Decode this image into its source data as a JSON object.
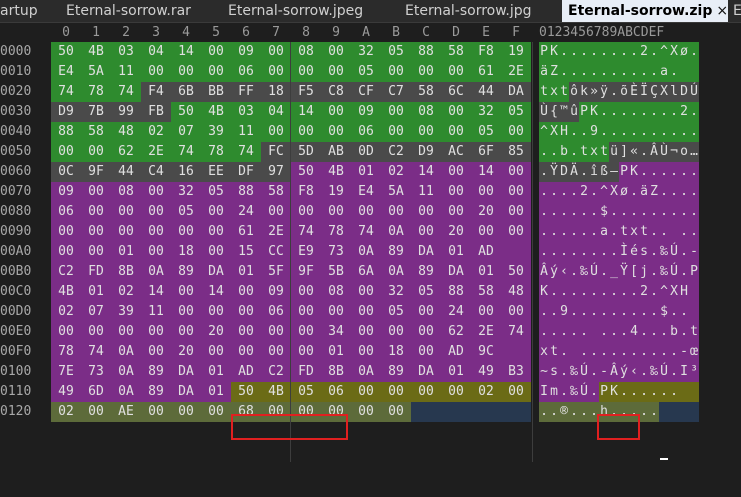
{
  "tabs": [
    {
      "label": "artup"
    },
    {
      "label": "Eternal-sorrow.rar"
    },
    {
      "label": "Eternal-sorrow.jpeg"
    },
    {
      "label": "Eternal-sorrow.jpg"
    },
    {
      "label": "Eternal-sorrow.zip",
      "active": true
    },
    {
      "label": "E"
    }
  ],
  "close_glyph": "×",
  "column_headers": [
    "0",
    "1",
    "2",
    "3",
    "4",
    "5",
    "6",
    "7",
    "8",
    "9",
    "A",
    "B",
    "C",
    "D",
    "E",
    "F"
  ],
  "ascii_header": "0123456789ABCDEF",
  "colors": {
    "green": "#2e8b2e",
    "olive": "#6b6b16",
    "purple": "#7b2d87",
    "mid_grey": "#4a4a4a",
    "navy": "#27384f",
    "light_olive": "#5d6b3a",
    "highlight_border": "#e02020"
  },
  "rows": [
    {
      "offset": "0000",
      "bytes": [
        "50",
        "4B",
        "03",
        "04",
        "14",
        "00",
        "09",
        "00",
        "08",
        "00",
        "32",
        "05",
        "88",
        "58",
        "F8",
        "19"
      ],
      "ascii": "PK........2.^Xø."
    },
    {
      "offset": "0010",
      "bytes": [
        "E4",
        "5A",
        "11",
        "00",
        "00",
        "00",
        "06",
        "00",
        "00",
        "00",
        "05",
        "00",
        "00",
        "00",
        "61",
        "2E"
      ],
      "ascii": "äZ..........a."
    },
    {
      "offset": "0020",
      "bytes": [
        "74",
        "78",
        "74",
        "F4",
        "6B",
        "BB",
        "FF",
        "18",
        "F5",
        "C8",
        "CF",
        "C7",
        "58",
        "6C",
        "44",
        "DA"
      ],
      "ascii": "txtôk»ÿ.õÈÏÇXlDÚ"
    },
    {
      "offset": "0030",
      "bytes": [
        "D9",
        "7B",
        "99",
        "FB",
        "50",
        "4B",
        "03",
        "04",
        "14",
        "00",
        "09",
        "00",
        "08",
        "00",
        "32",
        "05"
      ],
      "ascii": "Ù{™ûPK........2."
    },
    {
      "offset": "0040",
      "bytes": [
        "88",
        "58",
        "48",
        "02",
        "07",
        "39",
        "11",
        "00",
        "00",
        "00",
        "06",
        "00",
        "00",
        "00",
        "05",
        "00"
      ],
      "ascii": "^XH..9.........."
    },
    {
      "offset": "0050",
      "bytes": [
        "00",
        "00",
        "62",
        "2E",
        "74",
        "78",
        "74",
        "FC",
        "5D",
        "AB",
        "0D",
        "C2",
        "D9",
        "AC",
        "6F",
        "85"
      ],
      "ascii": "..b.txtü]«.ÂÙ¬o…"
    },
    {
      "offset": "0060",
      "bytes": [
        "0C",
        "9F",
        "44",
        "C4",
        "16",
        "EE",
        "DF",
        "97",
        "50",
        "4B",
        "01",
        "02",
        "14",
        "00",
        "14",
        "00"
      ],
      "ascii": ".ŸDÄ.îß—PK......"
    },
    {
      "offset": "0070",
      "bytes": [
        "09",
        "00",
        "08",
        "00",
        "32",
        "05",
        "88",
        "58",
        "F8",
        "19",
        "E4",
        "5A",
        "11",
        "00",
        "00",
        "00"
      ],
      "ascii": "....2.^Xø.äZ...."
    },
    {
      "offset": "0080",
      "bytes": [
        "06",
        "00",
        "00",
        "00",
        "05",
        "00",
        "24",
        "00",
        "00",
        "00",
        "00",
        "00",
        "00",
        "00",
        "20",
        "00"
      ],
      "ascii": "......$......... "
    },
    {
      "offset": "0090",
      "bytes": [
        "00",
        "00",
        "00",
        "00",
        "00",
        "00",
        "61",
        "2E",
        "74",
        "78",
        "74",
        "0A",
        "00",
        "20",
        "00",
        "00"
      ],
      "ascii": "......a.txt.. .."
    },
    {
      "offset": "00A0",
      "bytes": [
        "00",
        "00",
        "01",
        "00",
        "18",
        "00",
        "15",
        "CC",
        "E9",
        "73",
        "0A",
        "89",
        "DA",
        "01",
        "AD"
      ],
      "ascii": "........Ìés.‰Ú.-"
    },
    {
      "offset": "00B0",
      "bytes": [
        "C2",
        "FD",
        "8B",
        "0A",
        "89",
        "DA",
        "01",
        "5F",
        "9F",
        "5B",
        "6A",
        "0A",
        "89",
        "DA",
        "01",
        "50"
      ],
      "ascii": "Âý‹.‰Ú._Ÿ[j.‰Ú.P"
    },
    {
      "offset": "00C0",
      "bytes": [
        "4B",
        "01",
        "02",
        "14",
        "00",
        "14",
        "00",
        "09",
        "00",
        "08",
        "00",
        "32",
        "05",
        "88",
        "58",
        "48"
      ],
      "ascii": "K.........2.^XH"
    },
    {
      "offset": "00D0",
      "bytes": [
        "02",
        "07",
        "39",
        "11",
        "00",
        "00",
        "00",
        "06",
        "00",
        "00",
        "00",
        "05",
        "00",
        "24",
        "00",
        "00"
      ],
      "ascii": "..9.........$.."
    },
    {
      "offset": "00E0",
      "bytes": [
        "00",
        "00",
        "00",
        "00",
        "00",
        "20",
        "00",
        "00",
        "00",
        "34",
        "00",
        "00",
        "00",
        "62",
        "2E",
        "74"
      ],
      "ascii": "..... ...4...b.t"
    },
    {
      "offset": "00F0",
      "bytes": [
        "78",
        "74",
        "0A",
        "00",
        "20",
        "00",
        "00",
        "00",
        "00",
        "01",
        "00",
        "18",
        "00",
        "AD",
        "9C"
      ],
      "ascii": "xt. ..........-œ"
    },
    {
      "offset": "0100",
      "bytes": [
        "7E",
        "73",
        "0A",
        "89",
        "DA",
        "01",
        "AD",
        "C2",
        "FD",
        "8B",
        "0A",
        "89",
        "DA",
        "01",
        "49",
        "B3"
      ],
      "ascii": "~s.‰Ú.-Âý‹.‰Ú.I³"
    },
    {
      "offset": "0110",
      "bytes": [
        "49",
        "6D",
        "0A",
        "89",
        "DA",
        "01",
        "50",
        "4B",
        "05",
        "06",
        "00",
        "00",
        "00",
        "00",
        "02",
        "00"
      ],
      "ascii": "Im.‰Ú.PK......"
    },
    {
      "offset": "0120",
      "bytes": [
        "02",
        "00",
        "AE",
        "00",
        "00",
        "00",
        "68",
        "00",
        "00",
        "00",
        "00",
        "00"
      ],
      "ascii": "..®...h....."
    }
  ],
  "row_colors": [
    [
      "green",
      "green",
      "green",
      "green",
      "green",
      "green",
      "green",
      "green",
      "green",
      "green",
      "green",
      "green",
      "green",
      "green",
      "green",
      "green"
    ],
    [
      "green",
      "green",
      "green",
      "green",
      "green",
      "green",
      "green",
      "green",
      "green",
      "green",
      "green",
      "green",
      "green",
      "green",
      "green",
      "green"
    ],
    [
      "green",
      "green",
      "green",
      "mid_grey",
      "mid_grey",
      "mid_grey",
      "mid_grey",
      "mid_grey",
      "mid_grey",
      "mid_grey",
      "mid_grey",
      "mid_grey",
      "mid_grey",
      "mid_grey",
      "mid_grey",
      "mid_grey"
    ],
    [
      "mid_grey",
      "mid_grey",
      "mid_grey",
      "mid_grey",
      "green",
      "green",
      "green",
      "green",
      "green",
      "green",
      "green",
      "green",
      "green",
      "green",
      "green",
      "green"
    ],
    [
      "green",
      "green",
      "green",
      "green",
      "green",
      "green",
      "green",
      "green",
      "green",
      "green",
      "green",
      "green",
      "green",
      "green",
      "green",
      "green"
    ],
    [
      "green",
      "green",
      "green",
      "green",
      "green",
      "green",
      "green",
      "mid_grey",
      "mid_grey",
      "mid_grey",
      "mid_grey",
      "mid_grey",
      "mid_grey",
      "mid_grey",
      "mid_grey",
      "mid_grey"
    ],
    [
      "mid_grey",
      "mid_grey",
      "mid_grey",
      "mid_grey",
      "mid_grey",
      "mid_grey",
      "mid_grey",
      "mid_grey",
      "purple",
      "purple",
      "purple",
      "purple",
      "purple",
      "purple",
      "purple",
      "purple"
    ],
    [
      "purple",
      "purple",
      "purple",
      "purple",
      "purple",
      "purple",
      "purple",
      "purple",
      "purple",
      "purple",
      "purple",
      "purple",
      "purple",
      "purple",
      "purple",
      "purple"
    ],
    [
      "purple",
      "purple",
      "purple",
      "purple",
      "purple",
      "purple",
      "purple",
      "purple",
      "purple",
      "purple",
      "purple",
      "purple",
      "purple",
      "purple",
      "purple",
      "purple"
    ],
    [
      "purple",
      "purple",
      "purple",
      "purple",
      "purple",
      "purple",
      "purple",
      "purple",
      "purple",
      "purple",
      "purple",
      "purple",
      "purple",
      "purple",
      "purple",
      "purple"
    ],
    [
      "purple",
      "purple",
      "purple",
      "purple",
      "purple",
      "purple",
      "purple",
      "purple",
      "purple",
      "purple",
      "purple",
      "purple",
      "purple",
      "purple",
      "purple",
      "purple"
    ],
    [
      "purple",
      "purple",
      "purple",
      "purple",
      "purple",
      "purple",
      "purple",
      "purple",
      "purple",
      "purple",
      "purple",
      "purple",
      "purple",
      "purple",
      "purple",
      "purple"
    ],
    [
      "purple",
      "purple",
      "purple",
      "purple",
      "purple",
      "purple",
      "purple",
      "purple",
      "purple",
      "purple",
      "purple",
      "purple",
      "purple",
      "purple",
      "purple",
      "purple"
    ],
    [
      "purple",
      "purple",
      "purple",
      "purple",
      "purple",
      "purple",
      "purple",
      "purple",
      "purple",
      "purple",
      "purple",
      "purple",
      "purple",
      "purple",
      "purple",
      "purple"
    ],
    [
      "purple",
      "purple",
      "purple",
      "purple",
      "purple",
      "purple",
      "purple",
      "purple",
      "purple",
      "purple",
      "purple",
      "purple",
      "purple",
      "purple",
      "purple",
      "purple"
    ],
    [
      "purple",
      "purple",
      "purple",
      "purple",
      "purple",
      "purple",
      "purple",
      "purple",
      "purple",
      "purple",
      "purple",
      "purple",
      "purple",
      "purple",
      "purple",
      "purple"
    ],
    [
      "purple",
      "purple",
      "purple",
      "purple",
      "purple",
      "purple",
      "purple",
      "purple",
      "purple",
      "purple",
      "purple",
      "purple",
      "purple",
      "purple",
      "purple",
      "purple"
    ],
    [
      "purple",
      "purple",
      "purple",
      "purple",
      "purple",
      "purple",
      "olive",
      "olive",
      "olive",
      "olive",
      "olive",
      "olive",
      "olive",
      "olive",
      "olive",
      "olive"
    ],
    [
      "light_olive",
      "light_olive",
      "light_olive",
      "light_olive",
      "light_olive",
      "light_olive",
      "light_olive",
      "light_olive",
      "light_olive",
      "light_olive",
      "light_olive",
      "light_olive",
      "navy",
      "navy",
      "navy",
      "navy"
    ]
  ]
}
